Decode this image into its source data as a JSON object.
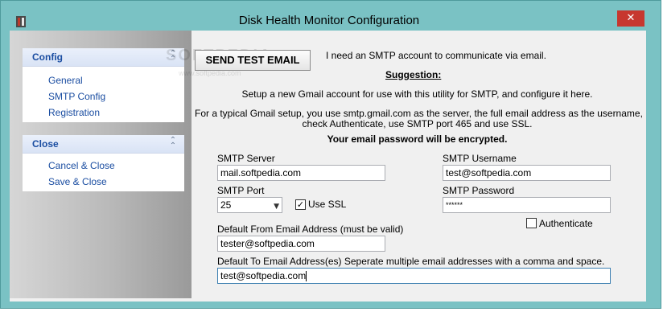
{
  "window": {
    "title": "Disk Health Monitor Configuration",
    "close_glyph": "✕",
    "accent_color": "#7ac2c4",
    "close_color": "#c7372f"
  },
  "sidebar": {
    "groups": [
      {
        "title": "Config",
        "icon": "chevron-double-up-icon",
        "items": [
          {
            "label": "General"
          },
          {
            "label": "SMTP Config"
          },
          {
            "label": "Registration"
          }
        ]
      },
      {
        "title": "Close",
        "icon": "chevron-double-up-icon",
        "items": [
          {
            "label": "Cancel & Close"
          },
          {
            "label": "Save & Close"
          }
        ]
      }
    ]
  },
  "main": {
    "send_test_button": "SEND TEST EMAIL",
    "smtp_notice": "I need an SMTP account to communicate via email.",
    "suggestion_heading": "Suggestion:",
    "suggestion_text": "Setup a new Gmail account for use with this utility for SMTP, and configure it here.",
    "gmail_line1": "For a typical Gmail setup, you use smtp.gmail.com as the server, the full email address as the username,",
    "gmail_line2": "check Authenticate, use SMTP port 465 and use SSL.",
    "encrypted_notice": "Your email password will be encrypted.",
    "smtp_server_label": "SMTP Server",
    "smtp_server_value": "mail.softpedia.com",
    "smtp_username_label": "SMTP Username",
    "smtp_username_value": "test@softpedia.com",
    "smtp_port_label": "SMTP Port",
    "smtp_port_value": "25",
    "use_ssl_label": "Use SSL",
    "use_ssl_checked": true,
    "smtp_password_label": "SMTP Password",
    "smtp_password_value": "******",
    "authenticate_label": "Authenticate",
    "authenticate_checked": false,
    "from_label": "Default From Email Address (must be valid)",
    "from_value": "tester@softpedia.com",
    "to_label": "Default To Email Address(es)  Seperate multiple email addresses with a comma and space.",
    "to_value": "test@softpedia.com"
  },
  "watermark": {
    "text": "SOFTPEDIA",
    "url": "www.softpedia.com"
  }
}
